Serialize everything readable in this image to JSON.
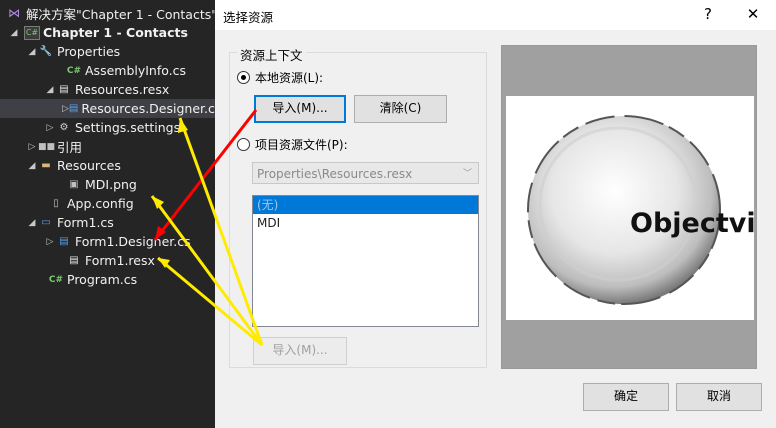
{
  "solution_explorer": {
    "title": "解决方案\"Chapter 1 - Contacts\"(",
    "project": "Chapter 1 - Contacts",
    "items": [
      {
        "label": "Properties",
        "icon": "wrench-icon"
      },
      {
        "label": "AssemblyInfo.cs",
        "icon": "csharp-file-icon"
      },
      {
        "label": "Resources.resx",
        "icon": "resx-file-icon"
      },
      {
        "label": "Resources.Designer.cs",
        "icon": "designer-file-icon"
      },
      {
        "label": "Settings.settings",
        "icon": "settings-icon"
      },
      {
        "label": "引用",
        "icon": "references-icon"
      },
      {
        "label": "Resources",
        "icon": "folder-icon"
      },
      {
        "label": "MDI.png",
        "icon": "image-file-icon"
      },
      {
        "label": "App.config",
        "icon": "config-file-icon"
      },
      {
        "label": "Form1.cs",
        "icon": "form-file-icon"
      },
      {
        "label": "Form1.Designer.cs",
        "icon": "designer-file-icon"
      },
      {
        "label": "Form1.resx",
        "icon": "resx-file-icon"
      },
      {
        "label": "Program.cs",
        "icon": "csharp-file-icon"
      }
    ]
  },
  "dialog": {
    "title": "选择资源",
    "help": "?",
    "close": "✕",
    "group_label": "资源上下文",
    "local_resource_label": "本地资源(L):",
    "import_button": "导入(M)...",
    "clear_button": "清除(C)",
    "project_resource_label": "项目资源文件(P):",
    "project_resource_value": "Properties\\Resources.resx",
    "resource_list": [
      "(无)",
      "MDI"
    ],
    "project_import_button": "导入(M)...",
    "preview_text": "Objectvi",
    "ok_button": "确定",
    "cancel_button": "取消"
  },
  "colors": {
    "ide_background": "#252526",
    "selection_blue": "#0078d7",
    "arrow_yellow": "#ffeb00",
    "arrow_red": "#ff0000"
  }
}
